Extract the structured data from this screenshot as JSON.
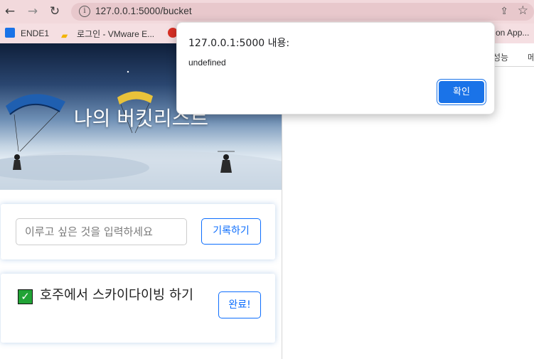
{
  "browser": {
    "url": "127.0.0.1:5000/bucket",
    "nav": {
      "back": "←",
      "forward": "→",
      "reload": "↻"
    },
    "info_icon": "i",
    "share_icon": "⇪",
    "star_icon": "☆"
  },
  "bookmarks": [
    {
      "label": "ENDE1"
    },
    {
      "label": "로그인 - VMware E..."
    },
    {
      "label": ""
    },
    {
      "label": "on App..."
    }
  ],
  "devtools": {
    "tabs": [
      "성능",
      "메"
    ]
  },
  "page": {
    "hero_title": "나의 버킷리스트",
    "input_placeholder": "이루고 싶은 것을 입력하세요",
    "save_button": "기록하기",
    "items": [
      {
        "text": "호주에서 스카이다이빙 하기",
        "done_button": "완료!",
        "checked": true
      }
    ]
  },
  "dialog": {
    "title": "127.0.0.1:5000 내용:",
    "message": "undefined",
    "ok_button": "확인"
  },
  "colors": {
    "accent": "#0d6efd",
    "dialog_button": "#1a73e8",
    "toolbar": "#f2d9dc"
  }
}
